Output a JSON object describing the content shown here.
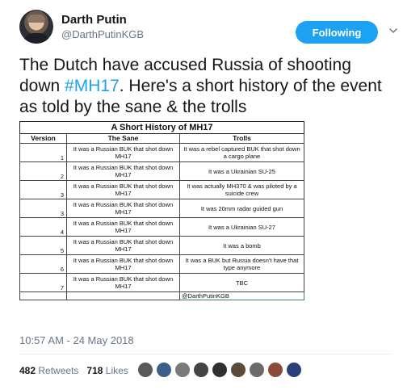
{
  "author": {
    "name": "Darth Putin",
    "handle": "@DarthPutinKGB"
  },
  "follow_button": {
    "label": "Following"
  },
  "tweet": {
    "text_before": "The Dutch have accused Russia of shooting down ",
    "hashtag": "#MH17",
    "text_after": ". Here's a short history of the event as told by the sane & the trolls"
  },
  "table": {
    "title": "A Short History of MH17",
    "headers": [
      "Version",
      "The Sane",
      "Trolls"
    ],
    "rows": [
      {
        "version": "1",
        "sane": "It was a Russian BUK that shot down MH17",
        "trolls": "It was a rebel captured BUK that shot down a cargo plane"
      },
      {
        "version": "2",
        "sane": "It was a Russian BUK that shot down MH17",
        "trolls": "It was a Ukrainian SU-25"
      },
      {
        "version": "3",
        "sane": "It was a Russian BUK that shot down MH17",
        "trolls": "It was actually MH370 & was piloted by a suicide crew"
      },
      {
        "version": "3",
        "sane": "It was a Russian BUK that shot down MH17",
        "trolls": "It was 20mm radar guided gun"
      },
      {
        "version": "4",
        "sane": "It was a Russian BUK that shot down MH17",
        "trolls": "It was a Ukrainian SU-27"
      },
      {
        "version": "5",
        "sane": "It was a Russian BUK that shot down MH17",
        "trolls": "It was a bomb"
      },
      {
        "version": "6",
        "sane": "It was a Russian BUK that shot down MH17",
        "trolls": "It was a BUK but Russia doesn't have that type anymore"
      },
      {
        "version": "7",
        "sane": "It was a Russian BUK that shot down MH17",
        "trolls": "TBC"
      }
    ],
    "footer_handle": "@DarthPutinKGB"
  },
  "timestamp": "10:57 AM - 24 May 2018",
  "stats": {
    "retweets_count": "482",
    "retweets_label": "Retweets",
    "likes_count": "718",
    "likes_label": "Likes"
  },
  "liker_colors": [
    "#5a5a5a",
    "#3b5f8a",
    "#7a7a7a",
    "#444444",
    "#2f2f2f",
    "#5c4a3a",
    "#6b6b6b",
    "#8a4b3a",
    "#2b3f7a"
  ]
}
